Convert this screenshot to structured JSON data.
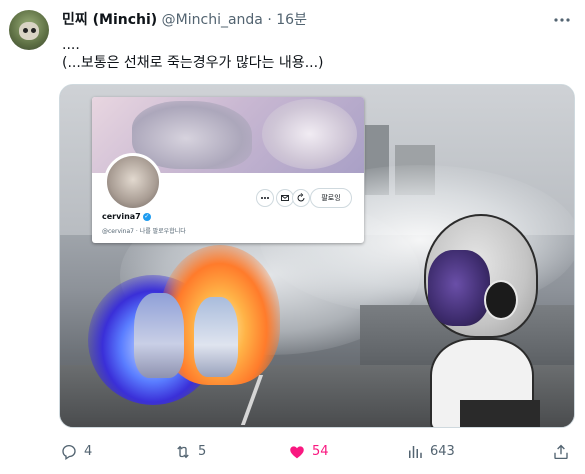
{
  "author": {
    "display_name": "민찌 (Minchi)",
    "handle": "@Minchi_anda",
    "separator": "·",
    "time": "16분"
  },
  "tweet_text": {
    "line1": "....",
    "line2": "(...보통은 선채로 죽는경우가 많다는 내용...)"
  },
  "media": {
    "embedded_profile": {
      "name": "cervina7",
      "handle_and_note": "@cervina7 · 나를 팔로우합니다",
      "follow_label": "팔로잉",
      "button_icons": [
        "more-icon",
        "mail-icon",
        "refresh-icon"
      ]
    }
  },
  "actions": {
    "reply": {
      "count": "4",
      "icon": "reply-icon"
    },
    "retweet": {
      "count": "5",
      "icon": "retweet-icon"
    },
    "like": {
      "count": "54",
      "icon": "heart-icon",
      "active": true,
      "color": "#f91880"
    },
    "views": {
      "count": "643",
      "icon": "views-icon"
    },
    "share": {
      "icon": "share-icon"
    }
  },
  "colors": {
    "text_primary": "#0f1419",
    "text_secondary": "#536471",
    "like_active": "#f91880",
    "verified": "#1d9bf0"
  }
}
